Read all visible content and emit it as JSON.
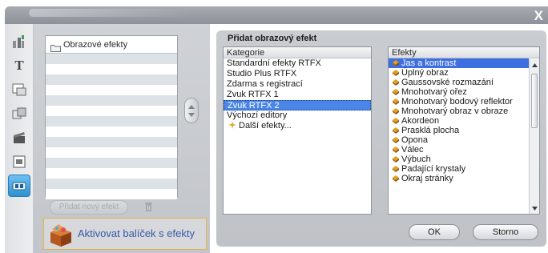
{
  "window": {
    "close_glyph": "X"
  },
  "toolbar": {
    "items": [
      {
        "name": "video-effects-icon",
        "glyph": ""
      },
      {
        "name": "title-icon",
        "glyph": "T"
      },
      {
        "name": "picture-in-picture-icon",
        "glyph": ""
      },
      {
        "name": "transition-icon",
        "glyph": ""
      },
      {
        "name": "clapboard-icon",
        "glyph": ""
      },
      {
        "name": "menu-icon",
        "glyph": ""
      },
      {
        "name": "audio-effects-icon",
        "glyph": ""
      }
    ],
    "active_index": 6
  },
  "left_panel": {
    "list_header": "Obrazové efekty",
    "add_button": "Přidat nový efekt",
    "activate_label": "Aktivovat balíček s efekty"
  },
  "dialog": {
    "title": "Přidat obrazový efekt",
    "category_header": "Kategorie",
    "categories": [
      "Standardní efekty RTFX",
      "Studio Plus RTFX",
      "Zdarma s registrací",
      "Zvuk RTFX 1",
      "Zvuk RTFX 2",
      "Výchozí editory",
      "Další efekty..."
    ],
    "selected_category_index": 4,
    "effects_header": "Efekty",
    "effects": [
      "Jas a kontrast",
      "Úplný obraz",
      "Gaussovské rozmazání",
      "Mnohotvarý ořez",
      "Mnohotvarý bodový reflektor",
      "Mnohotvarý obraz v obraze",
      "Akordeon",
      "Prasklá plocha",
      "Opona",
      "Válec",
      "Výbuch",
      "Padající krystaly",
      "Okraj stránky"
    ],
    "selected_effect_index": 0,
    "ok_label": "OK",
    "cancel_label": "Storno"
  },
  "colors": {
    "selection": "#4a86e8",
    "activate_border": "#e2b447",
    "activate_text": "#3b58a8",
    "toolbar_active": "#2f8fcf"
  }
}
